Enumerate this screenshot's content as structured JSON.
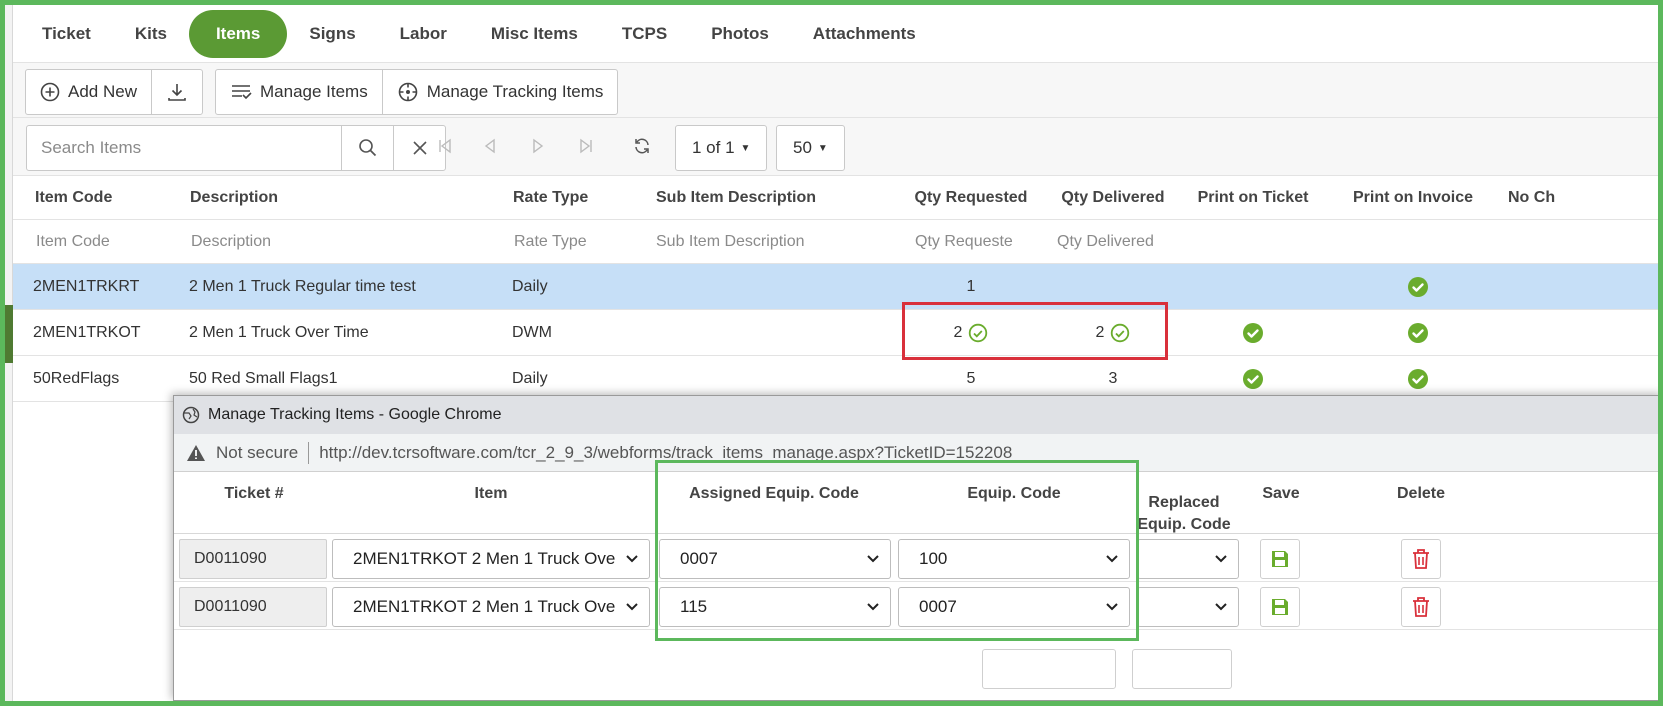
{
  "tabs": [
    {
      "label": "Ticket",
      "active": false
    },
    {
      "label": "Kits",
      "active": false
    },
    {
      "label": "Items",
      "active": true
    },
    {
      "label": "Signs",
      "active": false
    },
    {
      "label": "Labor",
      "active": false
    },
    {
      "label": "Misc Items",
      "active": false
    },
    {
      "label": "TCPS",
      "active": false
    },
    {
      "label": "Photos",
      "active": false
    },
    {
      "label": "Attachments",
      "active": false
    }
  ],
  "toolbar": {
    "add_new_label": "Add New",
    "manage_items_label": "Manage Items",
    "manage_tracking_label": "Manage Tracking Items"
  },
  "search": {
    "placeholder": "Search Items",
    "page_label": "1 of 1",
    "page_size": "50"
  },
  "grid": {
    "columns": [
      "Item Code",
      "Description",
      "Rate Type",
      "Sub Item Description",
      "Qty Requested",
      "Qty Delivered",
      "Print on Ticket",
      "Print on Invoice",
      "No Ch"
    ],
    "filters": [
      "Item Code",
      "Description",
      "Rate Type",
      "Sub Item Description",
      "Qty Requeste",
      "Qty Delivered"
    ],
    "rows": [
      {
        "code": "2MEN1TRKRT",
        "description": "2 Men 1 Truck Regular time test",
        "rate": "Daily",
        "sub": "",
        "qty_req": "1",
        "req_check": false,
        "qty_del": "",
        "del_check": false,
        "print_ticket": false,
        "print_invoice": true,
        "selected": true
      },
      {
        "code": "2MEN1TRKOT",
        "description": "2 Men 1 Truck Over Time",
        "rate": "DWM",
        "sub": "",
        "qty_req": "2",
        "req_check": true,
        "qty_del": "2",
        "del_check": true,
        "print_ticket": true,
        "print_invoice": true,
        "selected": false
      },
      {
        "code": "50RedFlags",
        "description": "50 Red Small Flags1",
        "rate": "Daily",
        "sub": "",
        "qty_req": "5",
        "req_check": false,
        "qty_del": "3",
        "del_check": false,
        "print_ticket": true,
        "print_invoice": true,
        "selected": false
      }
    ]
  },
  "popup": {
    "title": "Manage Tracking Items - Google Chrome",
    "security": "Not secure",
    "url": "http://dev.tcrsoftware.com/tcr_2_9_3/webforms/track_items_manage.aspx?TicketID=152208",
    "headers": {
      "ticket": "Ticket #",
      "item": "Item",
      "assigned": "Assigned Equip. Code",
      "equip": "Equip. Code",
      "replaced": "Replaced Equip. Code",
      "save": "Save",
      "delete": "Delete"
    },
    "rows": [
      {
        "ticket": "D0011090",
        "item": "2MEN1TRKOT 2 Men 1 Truck Ove",
        "assigned": "0007",
        "equip": "100",
        "replaced": ""
      },
      {
        "ticket": "D0011090",
        "item": "2MEN1TRKOT 2 Men 1 Truck Ove",
        "assigned": "115",
        "equip": "0007",
        "replaced": ""
      }
    ]
  },
  "colors": {
    "accent_green": "#5b9a34",
    "check_green": "#6aac2d",
    "highlight_red": "#d9303b",
    "highlight_green": "#5cb85c",
    "delete_red": "#d9303b",
    "selected_row": "#c6dff7"
  },
  "icons": {
    "add": "plus-circle-icon",
    "download": "download-icon",
    "manage_items": "list-filter-icon",
    "manage_tracking": "crosshair-icon",
    "search": "search-icon",
    "clear": "close-icon",
    "check": "check-circle-icon",
    "save": "floppy-disk-icon",
    "delete": "trash-icon"
  }
}
